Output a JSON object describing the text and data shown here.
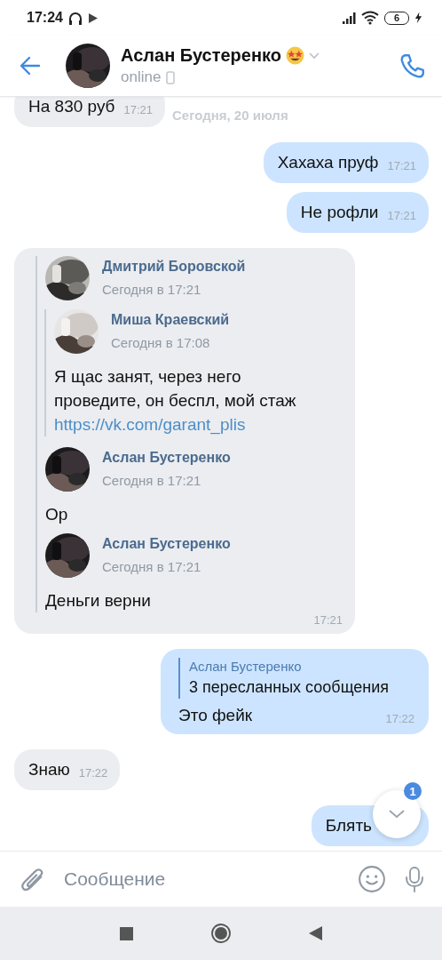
{
  "status_bar": {
    "time": "17:24",
    "battery": "6"
  },
  "header": {
    "name": "Аслан Бустеренко",
    "status": "online"
  },
  "date_label": "Сегодня, 20 июля",
  "messages": [
    {
      "kind": "text",
      "outgoing": false,
      "text": "На 830 руб",
      "time": "17:21"
    },
    {
      "kind": "text",
      "outgoing": true,
      "text": "Хахаха пруф",
      "time": "17:21"
    },
    {
      "kind": "text",
      "outgoing": true,
      "text": "Не рофли",
      "time": "17:21"
    },
    {
      "kind": "forward",
      "outgoing": false,
      "time": "17:21",
      "forwards": [
        {
          "author": "Дмитрий Боровской",
          "date": "Сегодня в 17:21",
          "forwards": [
            {
              "author": "Миша Краевский",
              "date": "Сегодня в 17:08",
              "text": "Я щас занят, через него проведите, он беспл, мой стаж",
              "link": "https://vk.com/garant_plis"
            }
          ]
        },
        {
          "author": "Аслан Бустеренко",
          "date": "Сегодня в 17:21",
          "text": "Ор"
        },
        {
          "author": "Аслан Бустеренко",
          "date": "Сегодня в 17:21",
          "text": "Деньги верни"
        }
      ]
    },
    {
      "kind": "forward_summary",
      "outgoing": true,
      "author": "Аслан Бустеренко",
      "summary": "3 пересланных сообщения",
      "text": "Это фейк",
      "time": "17:22"
    },
    {
      "kind": "text",
      "outgoing": false,
      "text": "Знаю",
      "time": "17:22"
    },
    {
      "kind": "text",
      "outgoing": true,
      "text": "Блять"
    }
  ],
  "scroll_button": {
    "badge": "1"
  },
  "composer": {
    "placeholder": "Сообщение"
  }
}
